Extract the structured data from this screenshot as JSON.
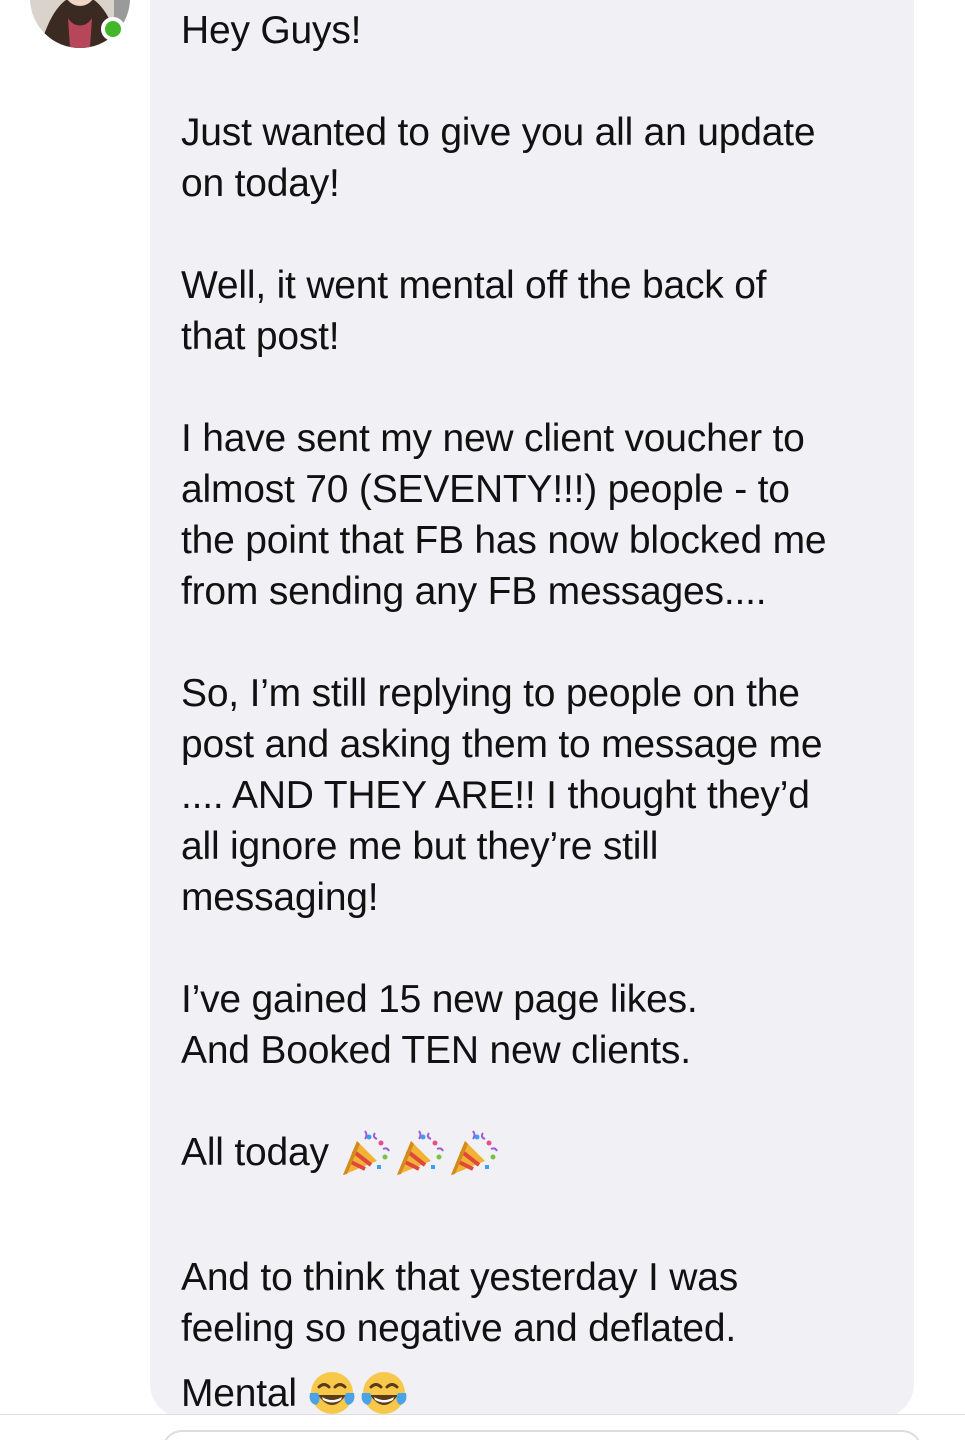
{
  "sender": {
    "avatar_icon": "profile-photo-avatar",
    "status_icon": "online-dot-icon",
    "status_color": "#42b72a"
  },
  "message": {
    "bubble_color": "#f1f1f5",
    "paragraphs": [
      [
        "Hey Guys!"
      ],
      [
        "Just wanted to give you all an update",
        "on today!"
      ],
      [
        "Well, it went mental off the back of",
        "that post!"
      ],
      [
        "I have sent my new client voucher to",
        "almost 70 (SEVENTY!!!) people - to",
        "the point that FB has now blocked me",
        "from sending any FB messages...."
      ],
      [
        "So, I’m still replying to people on the",
        "post and asking them to message me",
        ".... AND THEY ARE!! I thought they’d",
        "all ignore me but they’re still",
        "messaging!"
      ],
      [
        "I’ve gained 15 new page likes.",
        "And Booked TEN new clients."
      ]
    ],
    "all_today": {
      "text": "All today",
      "emoji_icon": "party-popper-emoji-icon",
      "emoji_count": 3
    },
    "closing": [
      "And to think that yesterday I was",
      "feeling so negative and deflated."
    ],
    "mental": {
      "text": "Mental",
      "emoji_icon": "tears-of-joy-emoji-icon",
      "emoji_count": 2
    }
  },
  "composer": {
    "input_icon": "message-input-field"
  }
}
